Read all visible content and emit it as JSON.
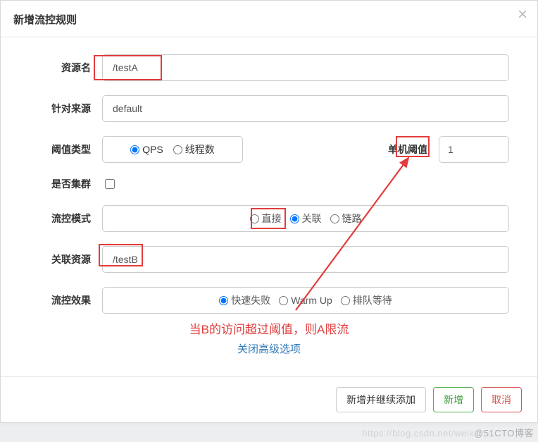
{
  "title": "新增流控规则",
  "labels": {
    "resource": "资源名",
    "limitApp": "针对来源",
    "thresholdType": "阈值类型",
    "singleThreshold": "单机阈值",
    "cluster": "是否集群",
    "flowMode": "流控模式",
    "refResource": "关联资源",
    "flowEffect": "流控效果"
  },
  "values": {
    "resource": "/testA",
    "limitApp": "default",
    "singleThreshold": "1",
    "refResource": "/testB"
  },
  "thresholdType": {
    "qps": "QPS",
    "threads": "线程数"
  },
  "flowMode": {
    "direct": "直接",
    "relate": "关联",
    "chain": "链路"
  },
  "flowEffect": {
    "failFast": "快速失败",
    "warmUp": "Warm Up",
    "queue": "排队等待"
  },
  "annotation": "当B的访问超过阈值，则A限流",
  "collapse": "关闭高级选项",
  "buttons": {
    "addContinue": "新增并继续添加",
    "add": "新增",
    "cancel": "取消"
  },
  "watermark_faint": "https://blog.csdn.net/weix",
  "watermark": "@51CTO博客"
}
